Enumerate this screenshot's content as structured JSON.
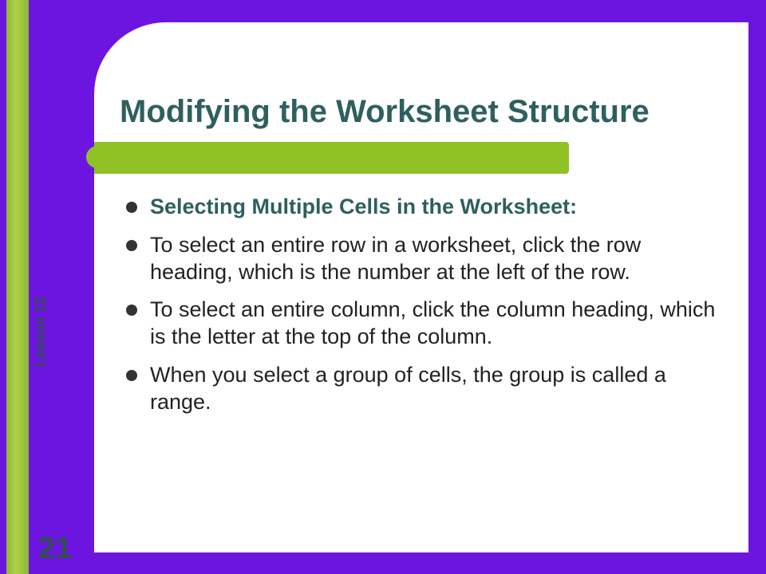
{
  "lesson_label": "Lesson 12",
  "page_number": "21",
  "slide": {
    "title": "Modifying the Worksheet Structure",
    "subtitle": "Selecting Multiple Cells in the Worksheet:",
    "bullets": [
      "To select an entire row in a worksheet, click the row heading, which is the number at the left of the row.",
      "To select an entire column, click the column heading, which is the letter at the top of the column.",
      "When you select a group of cells, the group is called a range."
    ]
  }
}
